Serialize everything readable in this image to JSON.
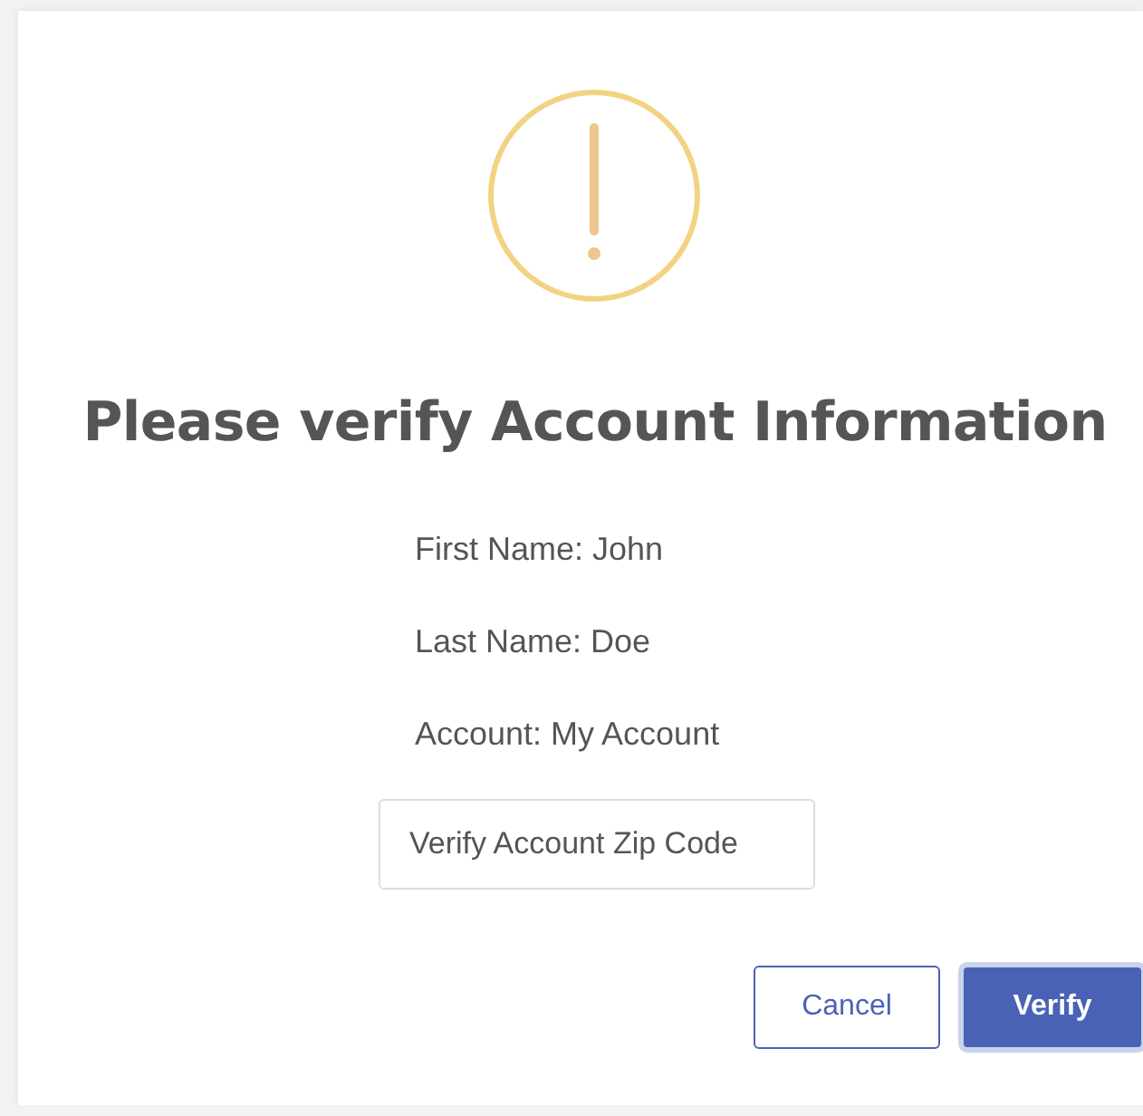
{
  "dialog": {
    "title": "Please verify Account Information",
    "details": [
      "First Name: John",
      "Last Name: Doe",
      "Account: My Account"
    ],
    "zip_field": {
      "placeholder": "Verify Account Zip Code"
    },
    "buttons": [
      {
        "label": "Cancel",
        "kind": "secondary"
      },
      {
        "label": "Verify",
        "kind": "primary"
      }
    ]
  }
}
